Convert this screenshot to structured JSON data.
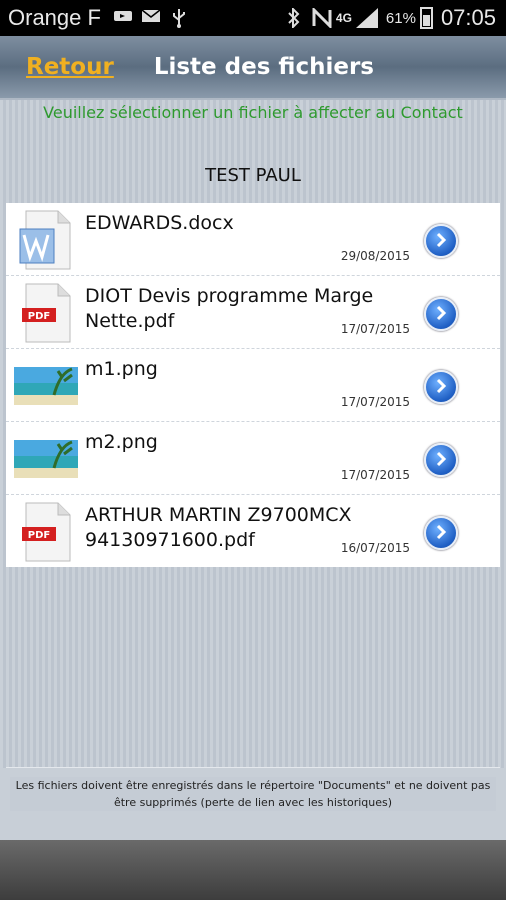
{
  "status_bar": {
    "carrier": "Orange F",
    "network": "4G",
    "battery": "61%",
    "time": "07:05",
    "icons": [
      "usb-icon",
      "email-icon",
      "usb-debug-icon",
      "bluetooth-icon",
      "nfc-icon"
    ]
  },
  "header": {
    "back_label": "Retour",
    "title": "Liste des fichiers"
  },
  "instruction": "Veuillez sélectionner un fichier à affecter au Contact",
  "contact_name": "TEST PAUL",
  "files": [
    {
      "name": "EDWARDS.docx",
      "date": "29/08/2015",
      "type": "doc"
    },
    {
      "name": "DIOT Devis programme Marge\nNette.pdf",
      "date": "17/07/2015",
      "type": "pdf"
    },
    {
      "name": "m1.png",
      "date": "17/07/2015",
      "type": "image"
    },
    {
      "name": "m2.png",
      "date": "17/07/2015",
      "type": "image"
    },
    {
      "name": "ARTHUR MARTIN Z9700MCX\n94130971600.pdf",
      "date": "16/07/2015",
      "type": "pdf"
    }
  ],
  "footer_note": "Les fichiers doivent être enregistrés dans le répertoire \"Documents\" et ne doivent pas être supprimés (perte de lien avec les historiques)",
  "colors": {
    "back_link": "#f0b020",
    "instruction": "#2e9a2e",
    "header": "#6b7c8f"
  }
}
